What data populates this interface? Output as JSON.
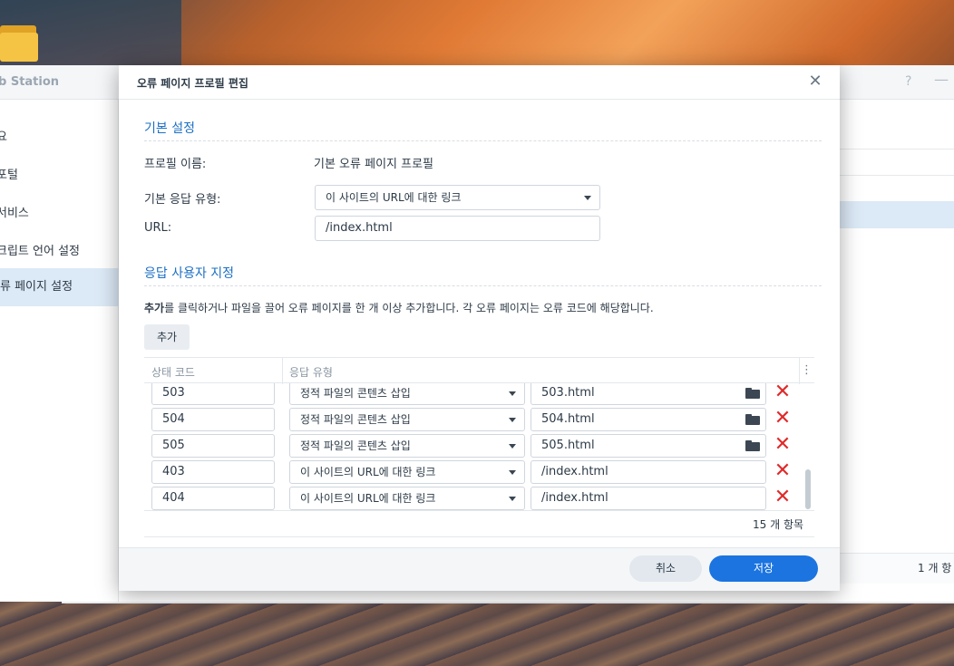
{
  "background_app": {
    "title": "b Station",
    "help": "?",
    "minimize": "—",
    "sidebar": [
      {
        "label": "요"
      },
      {
        "label": "포털"
      },
      {
        "label": "서비스"
      },
      {
        "label": "크립트 언어 설정"
      },
      {
        "label": "류 페이지 설정",
        "active": true
      }
    ],
    "footer_count": "1 개 항"
  },
  "modal": {
    "title": "오류 페이지 프로필 편집",
    "close": "✕",
    "basic_section": {
      "title": "기본 설정",
      "profile_name_label": "프로필 이름:",
      "profile_name_value": "기본 오류 페이지 프로필",
      "response_type_label": "기본 응답 유형:",
      "response_type_value": "이 사이트의 URL에 대한 링크",
      "url_label": "URL:",
      "url_value": "/index.html"
    },
    "custom_section": {
      "title": "응답 사용자 지정",
      "desc_bold": "추가",
      "desc_rest": "를 클릭하거나 파일을 끌어 오류 페이지를 한 개 이상 추가합니다. 각 오류 페이지는 오류 코드에 해당합니다.",
      "add_button": "추가",
      "columns": [
        "상태 코드",
        "응답 유형"
      ],
      "menu_icon": "⋮",
      "rows": [
        {
          "code": "503",
          "type": "정적 파일의 콘텐츠 삽입",
          "file": "503.html",
          "has_folder": true
        },
        {
          "code": "504",
          "type": "정적 파일의 콘텐츠 삽입",
          "file": "504.html",
          "has_folder": true
        },
        {
          "code": "505",
          "type": "정적 파일의 콘텐츠 삽입",
          "file": "505.html",
          "has_folder": true
        },
        {
          "code": "403",
          "type": "이 사이트의 URL에 대한 링크",
          "file": "/index.html",
          "has_folder": false
        },
        {
          "code": "404",
          "type": "이 사이트의 URL에 대한 링크",
          "file": "/index.html",
          "has_folder": false
        }
      ],
      "delete_icon": "✕",
      "item_count": "15 개 항목"
    },
    "footer": {
      "cancel": "취소",
      "save": "저장"
    }
  },
  "colors": {
    "accent": "#1b74e0",
    "section_title": "#1d6fc4",
    "delete": "#e02a2a",
    "sidebar_active": "#dce9f6"
  }
}
